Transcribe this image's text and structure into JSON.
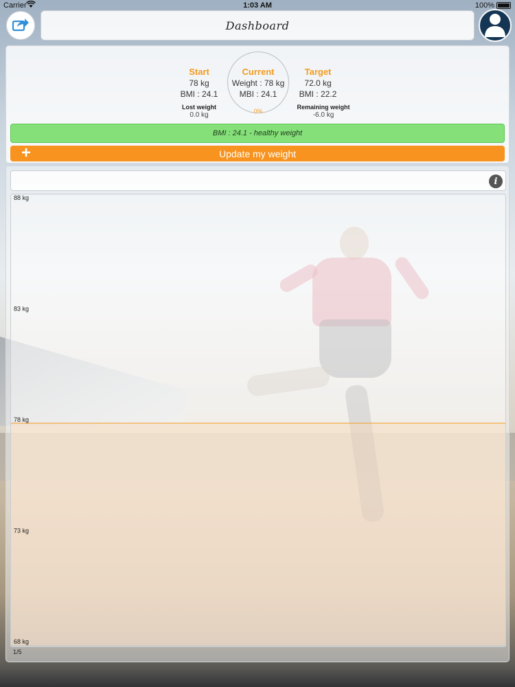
{
  "status_bar": {
    "carrier": "Carrier",
    "time": "1:03 AM",
    "battery": "100%"
  },
  "nav": {
    "title": "Dashboard"
  },
  "summary": {
    "start": {
      "title": "Start",
      "weight": "78 kg",
      "bmi": "BMI : 24.1"
    },
    "current": {
      "title": "Current",
      "weight": "Weight : 78 kg",
      "bmi": "MBI : 24.1",
      "progress": "0%"
    },
    "target": {
      "title": "Target",
      "weight": "72.0 kg",
      "bmi": "BMI : 22.2"
    },
    "lost": {
      "label": "Lost weight",
      "value": "0.0 kg"
    },
    "remaining": {
      "label": "Remaining weight",
      "value": "-6.0 kg"
    },
    "bmi_status": "BMI : 24.1 - healthy weight",
    "update_button": "Update my weight",
    "progress_fraction": 0
  },
  "colors": {
    "accent": "#f7931e",
    "healthy": "#86e07a",
    "chart_line": "#f39a1e",
    "chart_fill": "#f8d8b6"
  },
  "icons": {
    "share": "share-icon",
    "profile": "user-icon",
    "info": "info-icon",
    "plus": "plus-icon"
  },
  "chart_data": {
    "type": "area",
    "title": "",
    "xlabel": "",
    "ylabel": "",
    "ylim": [
      68,
      88
    ],
    "y_ticks": [
      "88 kg",
      "83 kg",
      "78 kg",
      "73 kg",
      "68 kg"
    ],
    "y_tick_values": [
      88,
      83,
      78,
      73,
      68
    ],
    "series": [
      {
        "values": [
          78,
          78
        ]
      }
    ],
    "page": "1/5"
  }
}
